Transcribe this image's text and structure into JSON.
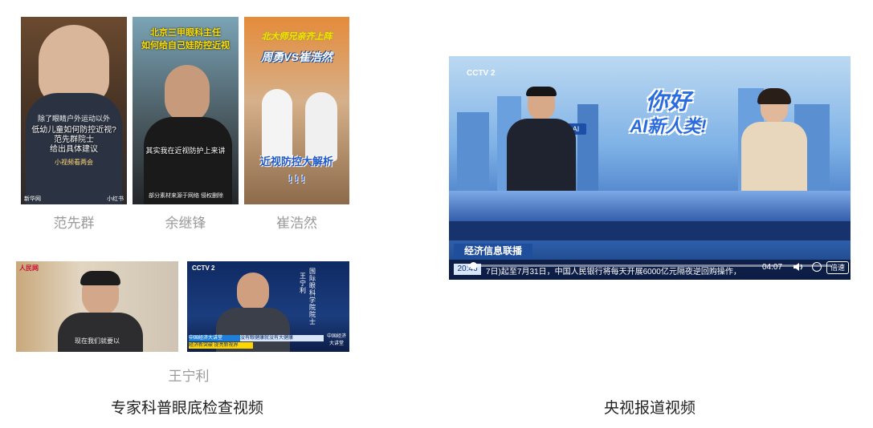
{
  "left_section": {
    "caption": "专家科普眼底检查视频",
    "videos": [
      {
        "name": "范先群",
        "subtitle_top": "除了眼睛户外运动以外",
        "subtitle_lines": [
          "低幼儿童如何防控近视?",
          "范先群院士",
          "给出具体建议"
        ],
        "tag": "小视频看两会",
        "corner_badge": "新华网",
        "corner_badge_right": "小红书"
      },
      {
        "name": "余继锋",
        "banner_lines": [
          "北京三甲眼科主任",
          "如何给自己娃防控近视"
        ],
        "subtitle": "其实我在近视防护上来讲",
        "small_note": "部分素材来源于网络 侵权删除"
      },
      {
        "name": "崔浩然",
        "top_line": "北大师兄亲齐上阵",
        "vs_line": "周勇VS崔浩然",
        "bottom_lines": [
          "近视防控大解析",
          "! ! !"
        ]
      },
      {
        "name": "王宁利",
        "logo": "人民网",
        "subtitle": "现在我们就要以"
      },
      {
        "name": "",
        "channel": "CCTV 2",
        "vertical_title": "国际眼科学院院士",
        "vertical_name": "王宁利",
        "lower_bar_1": "中国经济大讲堂",
        "lower_bar_2": "没有眼健康就没有大健康",
        "lower_bar_3": "经济新突破 提亮新视界",
        "brand": "中国经济大讲堂"
      }
    ],
    "bottom_name": "王宁利"
  },
  "right_section": {
    "caption": "央视报道视频",
    "video": {
      "channel": "CCTV 2",
      "headline": [
        "你好",
        "AI新人类!"
      ],
      "program": "经济信息联播",
      "time": "20:46",
      "ticker": "7日)起至7月31日，中国人民银行将每天开展6000亿元隔夜逆回购操作，",
      "elapsed": "04:07",
      "speed_label": "倍速",
      "ai_label": "AI"
    }
  },
  "colors": {
    "caption": "#222222",
    "name": "#9a9a9a",
    "cctv_blue": "#1f4e9c",
    "banner_yellow": "#ffe000"
  }
}
